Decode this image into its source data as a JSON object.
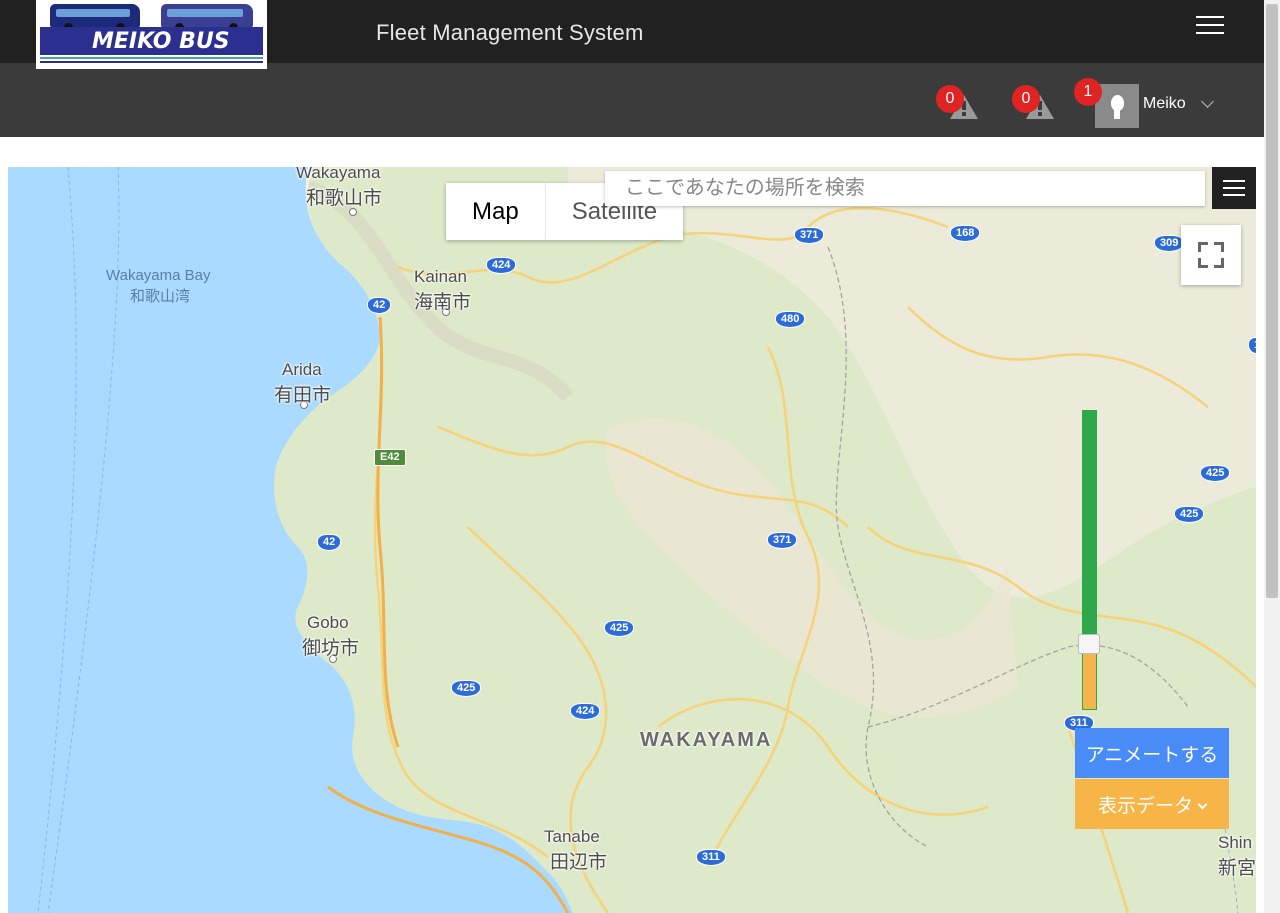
{
  "header": {
    "logo_text": "MEIKO BUS",
    "app_title": "Fleet Management System"
  },
  "notifications": [
    {
      "count": "0"
    },
    {
      "count": "0"
    }
  ],
  "user": {
    "badge_count": "1",
    "name": "Meiko"
  },
  "map": {
    "map_type_buttons": {
      "map": "Map",
      "satellite": "Satellite",
      "selected": "Map"
    },
    "search": {
      "placeholder": "ここであなたの場所を検索"
    },
    "labels": {
      "wakayama_en": "Wakayama",
      "wakayama_jp": "和歌山市",
      "bay_en": "Wakayama Bay",
      "bay_jp": "和歌山湾",
      "kainan_en": "Kainan",
      "kainan_jp": "海南市",
      "arida_en": "Arida",
      "arida_jp": "有田市",
      "gobo_en": "Gobo",
      "gobo_jp": "御坊市",
      "tanabe_en": "Tanabe",
      "tanabe_jp": "田辺市",
      "region": "WAKAYAMA",
      "shingu_en": "Shin",
      "shingu_jp": "新宮"
    },
    "routes": [
      "371",
      "168",
      "309",
      "424",
      "42",
      "480",
      "E42",
      "42",
      "371",
      "425",
      "425",
      "425",
      "424",
      "425",
      "311",
      "311",
      "1"
    ],
    "slider": {
      "value_fraction": 0.8
    },
    "colors": {
      "water": "#aadaff",
      "land": "#eef0e0",
      "road": "#fcd878",
      "slider_track": "#2ea84a",
      "slider_fill": "#f5b54a"
    }
  },
  "actions": {
    "animate_label": "アニメートする",
    "display_data_label": "表示データ"
  }
}
